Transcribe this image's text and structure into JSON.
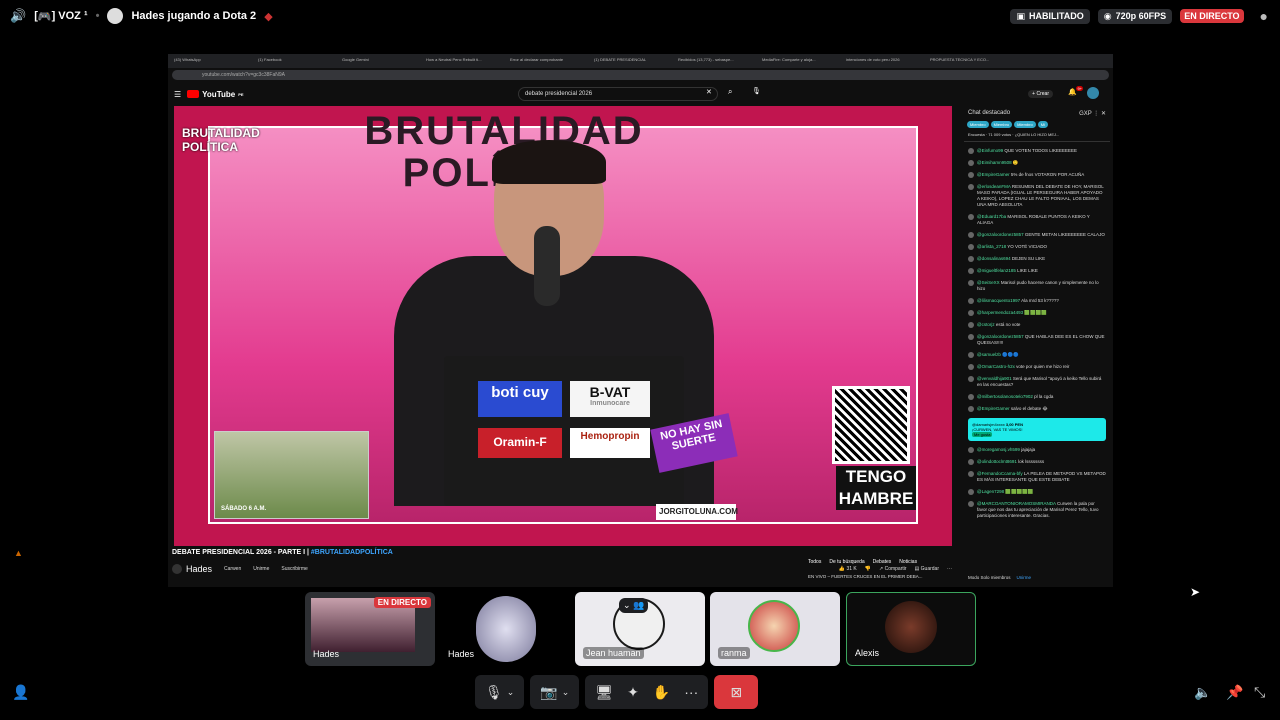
{
  "topbar": {
    "channel_prefix": "[ ",
    "channel_emoji": "🎮",
    "channel_name": " ] VOZ ¹",
    "activity": "Hades jugando a Dota 2",
    "habilitado": "HABILITADO",
    "quality": "720p 60FPS",
    "live": "EN DIRECTO"
  },
  "browser": {
    "tabs": [
      "(43) WhatsApp",
      "(1) Facebook",
      "Google Gemini",
      "How a Neutral Penc Rebuilt ti...",
      "Error al declarar comprobante",
      "(1) DEBATE PRESIDENCIAL",
      "Recibidos (13,773) - sebaspe...",
      "MediaFire: Comparte y aloja...",
      "intenciones de voto peru 2026",
      "PROPUESTA TECNICA Y ECO..."
    ],
    "url": "youtube.com/watch?v=gc3c38FaN9A"
  },
  "youtube": {
    "logo": "YouTube",
    "logo_sup": "PE",
    "search_value": "debate presidencial 2026",
    "create_label": "Crear",
    "notif_count": "9+"
  },
  "video": {
    "banner_line1": "BRUTALIDAD",
    "banner_line2": "POLÍTICA",
    "logo_line1": "BRUTALIDAD",
    "logo_line2": "POLÍTICA",
    "sticker_boticuy": "boti cuy",
    "sticker_bvat": "B-VAT",
    "sticker_bvat_sub": "Inmunocare",
    "sticker_oramin": "Oramin-F",
    "sticker_hemopropin": "Hemopropin",
    "sticker_suerte": "NO HAY SIN SUERTE",
    "sticker_web": "JORGITOLUNA.COM",
    "pip_caption": "SÁBADO 6 A.M.",
    "hambre_line1": "TENGO",
    "hambre_line2": "HAMBRE"
  },
  "below": {
    "title": "DEBATE PRESIDENCIAL 2026 - PARTE I | ",
    "hashtag": "#BRUTALIDADPOLÍTICA",
    "channel_overlay": "Hades",
    "channel_name": "Carwen",
    "join": "Unirme",
    "subscribe": "Suscribirme",
    "likes": "31 K",
    "share": "Compartir",
    "save": "Guardar",
    "more": "···",
    "filters": [
      "Todos",
      "De tu búsqueda",
      "Debates",
      "Noticias"
    ],
    "related_live": "EN VIVO – FUERTES CRUCES EN EL PRIMER DEBA..."
  },
  "chat": {
    "header": "Chat destacado",
    "gxp": "GXP",
    "chips": [
      "Miembro",
      "Miembro",
      "Miembro",
      "Mi"
    ],
    "pinned": "Encuesta · 71 009 votos · ¿QUIEN LO HIZO MEJ...",
    "messages": [
      {
        "user": "@Einfumo99",
        "text": "QUE VOTEN TODOS LIKEEEEEEE"
      },
      {
        "user": "@Eimihamn9508",
        "text": "🙂"
      },
      {
        "user": "@EmpireGamer",
        "text": "5% de fnos VOTARON POR ACUÑA"
      },
      {
        "user": "@erlosdeanFMA",
        "text": "RESUMEN DEL DEBATE DE HOY, MARISOL MASO PARADA (IGUAL LE PERSEGUIRA HABER APOYADO A KEIKO), LOPEZ CHAU LE FALTO PONIAAL, LOS DEMAS UNA MRD ABSOLUTA"
      },
      {
        "user": "@Eduard17ba",
        "text": "MARISOL ROBALE PUNTOS A KEIKO Y ALIAGA"
      },
      {
        "user": "@gonzaloordonez5857",
        "text": "GENTE METAN LIKEEEEEEE CALAJO"
      },
      {
        "user": "@arlista_2718",
        "text": "YO VOTÉ VICIADO"
      },
      {
        "user": "@donsalinas694",
        "text": "DEJEN SU LIKE"
      },
      {
        "user": "@migueltfelan2185",
        "text": "LIKE LIKE"
      },
      {
        "user": "@SeiSeXX",
        "text": "Marisol pudo hacerse canon y simplemente no lo hizo"
      },
      {
        "user": "@lilismacquento1997",
        "text": "Ala mrd 53 k?????"
      },
      {
        "user": "@harpermendoza4493",
        "text": "🟩🟩🟩🟩"
      },
      {
        "user": "@cstorjz",
        "text": "está no vote"
      },
      {
        "user": "@gonzaloordonez5857",
        "text": "QUE HABLAS DEE ES EL CHOW QUE QUEISAS!!!!!"
      },
      {
        "user": "@samuelzb",
        "text": "🔵🔵🔵"
      },
      {
        "user": "@OmarCastro-h2x",
        "text": "vote por quien me hizo reir"
      },
      {
        "user": "@venvaldhija901",
        "text": "Será que Marisol \"apoyó a keiko Tello subirá en las encuestas?"
      },
      {
        "user": "@milbertosolanosotelo7902",
        "text": "pl la cgda"
      },
      {
        "user": "@EmpireGamer",
        "text": "salvo el debate 😂"
      },
      {
        "user": "@moregamosj.vh599",
        "text": "jajajaja"
      },
      {
        "user": "@olindottoclmt8691",
        "text": "lok lssssssss"
      },
      {
        "user": "@FernandoCcama-bfy",
        "text": "LA PELEA DE METAPOD VS METAPOD ES MÁS INTERESANTE QUE ESTE DEBATE"
      },
      {
        "user": "@Lagen7298",
        "text": "🟩🟩🟩🟩🟩"
      },
      {
        "user": "@MARCOANTONIORAMOSMIRANDA",
        "text": "Curwen la pala por favor que nos das tu apreciación de Marisol Perez Tello, tuvo participaciones interesante. Gracias."
      }
    ],
    "superchat_amount": "3,00 PEN",
    "superchat_user": "@damarisjm4xxxx",
    "superchat_text": "¡CURWEN, VAS TE VIMOS!",
    "superchat_like": "Me gusta",
    "footer_mode": "Modo Solo miembros",
    "footer_join": "Unirme"
  },
  "tiles": [
    {
      "name": "Hades",
      "badge": "EN DIRECTO"
    },
    {
      "name": "Hades",
      "badge": ""
    },
    {
      "name": "Jean huaman",
      "badge": ""
    },
    {
      "name": "ranma",
      "badge": ""
    },
    {
      "name": "Alexis",
      "badge": ""
    }
  ]
}
